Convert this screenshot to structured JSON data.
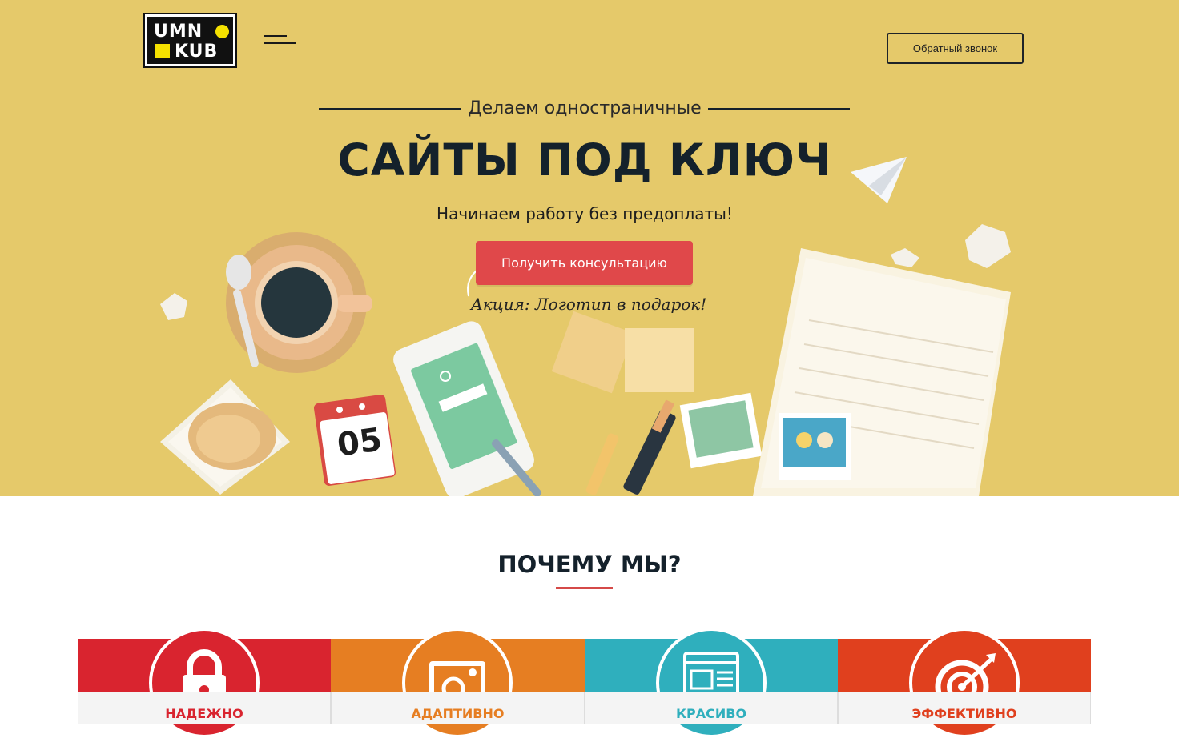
{
  "header": {
    "logo_line1": "UMN",
    "logo_line2": "KUB",
    "callback_label": "Обратный звонок"
  },
  "hero": {
    "subtitle": "Делаем одностраничные",
    "title": "САЙТЫ ПОД КЛЮЧ",
    "tagline": "Начинаем работу без предоплаты!",
    "cta_label": "Получить консультацию",
    "promo": "Акция: Логотип в подарок!",
    "calendar_day": "05",
    "bg_color": "#e5c96a"
  },
  "why": {
    "title": "ПОЧЕМУ МЫ?"
  },
  "features": [
    {
      "label": "НАДЕЖНО",
      "color": "#d9242f",
      "icon": "lock-icon"
    },
    {
      "label": "АДАПТИВНО",
      "color": "#e67e22",
      "icon": "adaptive-gear-icon"
    },
    {
      "label": "КРАСИВО",
      "color": "#2fafbd",
      "icon": "webpage-layout-icon"
    },
    {
      "label": "ЭФФЕКТИВНО",
      "color": "#e0401e",
      "icon": "target-icon"
    }
  ]
}
